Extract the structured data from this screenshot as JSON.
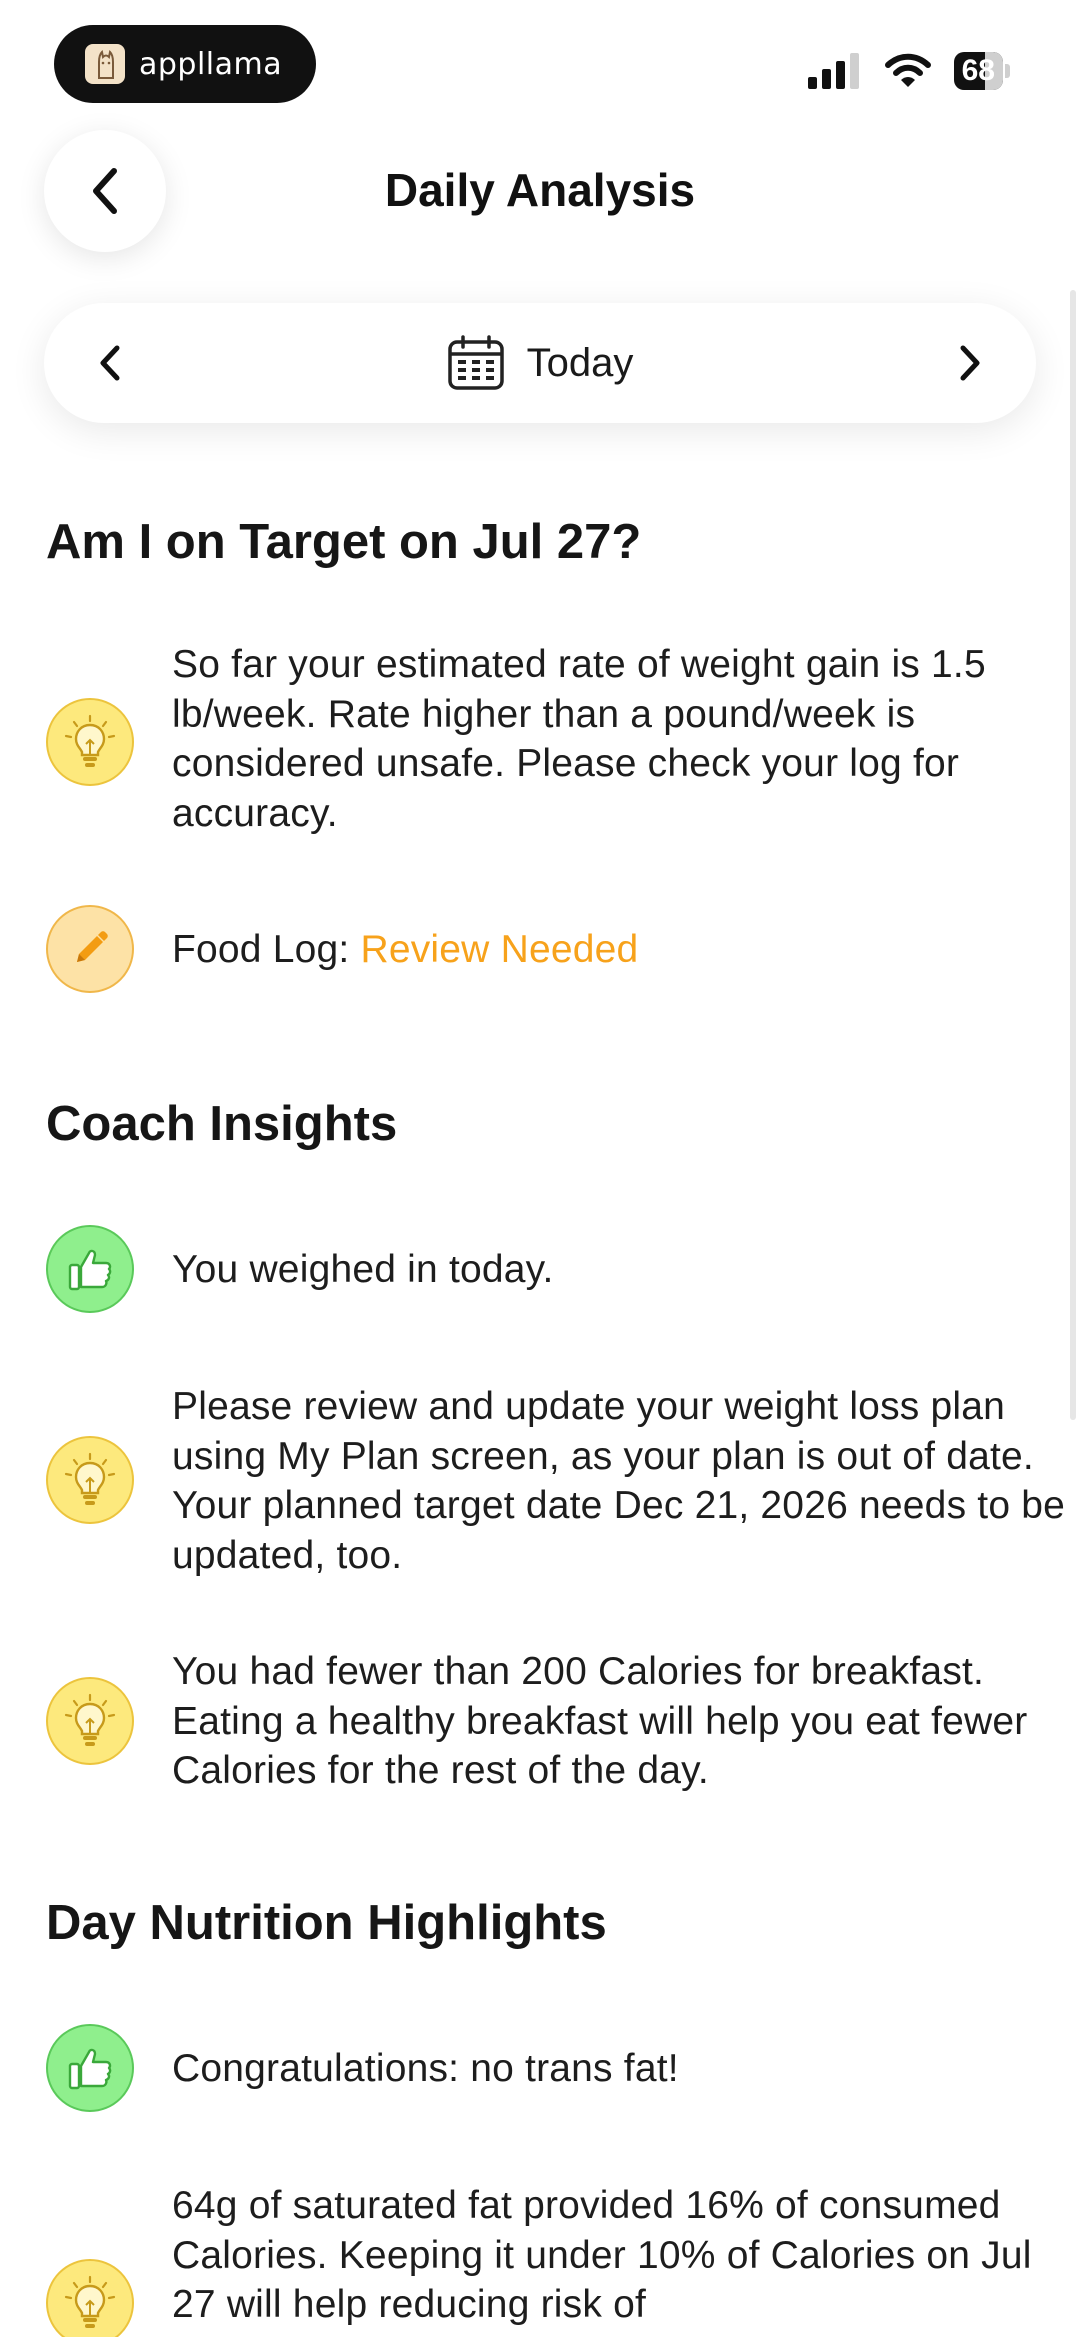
{
  "status_bar": {
    "app_name": "appllama",
    "battery": "68"
  },
  "header": {
    "title": "Daily Analysis"
  },
  "date_nav": {
    "label": "Today"
  },
  "target_section": {
    "title": "Am I on Target on Jul 27?",
    "items": [
      {
        "icon": "lightbulb-icon",
        "text": "So far your estimated rate of weight gain is 1.5 lb/week. Rate higher than a pound/week is considered unsafe. Please check your log for accuracy."
      }
    ],
    "food_log": {
      "icon": "pencil-icon",
      "label": "Food Log: ",
      "status": "Review Needed",
      "status_color": "#f7a21b"
    }
  },
  "coach_section": {
    "title": "Coach Insights",
    "items": [
      {
        "icon": "thumbs-up-icon",
        "text": "You weighed in today."
      },
      {
        "icon": "lightbulb-icon",
        "text": "Please review and update your weight loss plan using My Plan screen, as your plan is out of date. Your planned target date Dec 21, 2026 needs to be updated, too."
      },
      {
        "icon": "lightbulb-icon",
        "text": "You had fewer than 200 Calories for breakfast. Eating a healthy breakfast will help you eat fewer Calories for the rest of the day."
      }
    ]
  },
  "nutrition_section": {
    "title": "Day Nutrition Highlights",
    "items": [
      {
        "icon": "thumbs-up-icon",
        "text": "Congratulations: no trans fat!"
      },
      {
        "icon": "lightbulb-icon",
        "text": "64g of saturated fat provided 16% of consumed Calories. Keeping it under 10% of Calories on Jul 27 will help reducing risk of"
      }
    ]
  },
  "colors": {
    "accent_orange": "#f7a21b",
    "bulb_yellow": "#fde97d",
    "thumb_green": "#8fef8d"
  }
}
